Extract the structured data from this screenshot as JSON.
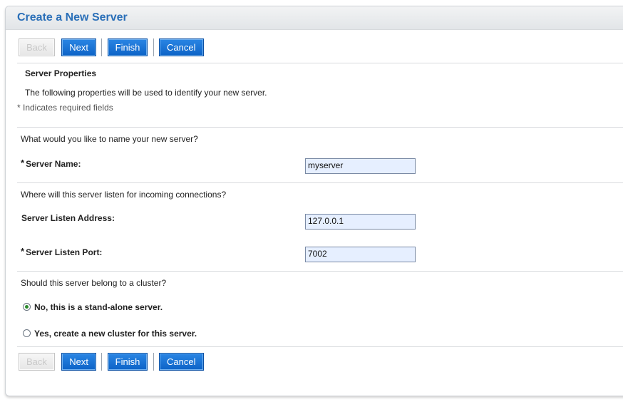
{
  "page": {
    "title": "Create a New Server"
  },
  "buttons": {
    "back": "Back",
    "next": "Next",
    "finish": "Finish",
    "cancel": "Cancel"
  },
  "section": {
    "heading": "Server Properties",
    "description": "The following properties will be used to identify your new server.",
    "required_note": "* Indicates required fields"
  },
  "questions": {
    "name": "What would you like to name your new server?",
    "listen": "Where will this server listen for incoming connections?",
    "cluster": "Should this server belong to a cluster?"
  },
  "fields": {
    "required_marker": "*",
    "server_name": {
      "label": "Server Name:",
      "value": "myserver",
      "required": true
    },
    "listen_address": {
      "label": "Server Listen Address:",
      "value": "127.0.0.1",
      "required": false
    },
    "listen_port": {
      "label": "Server Listen Port:",
      "value": "7002",
      "required": true
    }
  },
  "cluster_options": {
    "standalone": {
      "label": "No, this is a stand-alone server.",
      "selected": true
    },
    "new_cluster": {
      "label": "Yes, create a new cluster for this server.",
      "selected": false
    }
  },
  "colors": {
    "title": "#2a6fb8",
    "button": "#1573d6",
    "input_bg": "#e6efff"
  }
}
